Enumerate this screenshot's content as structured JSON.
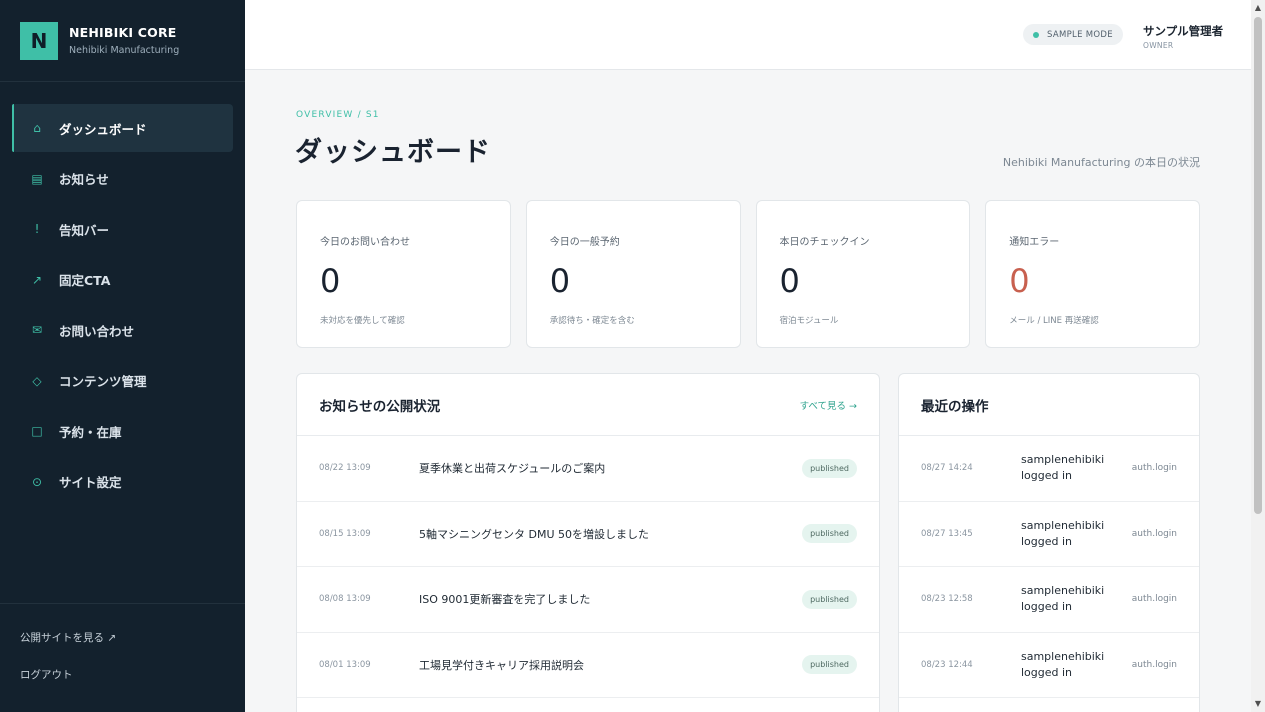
{
  "brand": {
    "logo_letter": "N",
    "name": "NEHIBIKI CORE",
    "sub": "Nehibiki Manufacturing"
  },
  "sidebar": {
    "items": [
      {
        "label": "ダッシュボード",
        "icon": "⌂",
        "active": true
      },
      {
        "label": "お知らせ",
        "icon": "▤"
      },
      {
        "label": "告知バー",
        "icon": "!"
      },
      {
        "label": "固定CTA",
        "icon": "↗"
      },
      {
        "label": "お問い合わせ",
        "icon": "✉"
      },
      {
        "label": "コンテンツ管理",
        "icon": "◇"
      },
      {
        "label": "予約・在庫",
        "icon": "□"
      },
      {
        "label": "サイト設定",
        "icon": "⊙"
      }
    ],
    "footer": {
      "public_site": "公開サイトを見る ↗",
      "logout": "ログアウト"
    }
  },
  "header": {
    "mode": "SAMPLE MODE",
    "user_name": "サンプル管理者",
    "user_role": "OWNER"
  },
  "page": {
    "crumb": "OVERVIEW / S1",
    "title": "ダッシュボード",
    "subtitle": "Nehibiki Manufacturing の本日の状況"
  },
  "stats": [
    {
      "label": "今日のお問い合わせ",
      "value": "0",
      "note": "未対応を優先して確認"
    },
    {
      "label": "今日の一般予約",
      "value": "0",
      "note": "承認待ち・確定を含む"
    },
    {
      "label": "本日のチェックイン",
      "value": "0",
      "note": "宿泊モジュール"
    },
    {
      "label": "通知エラー",
      "value": "0",
      "note": "メール / LINE 再送確認"
    }
  ],
  "news": {
    "title": "お知らせの公開状況",
    "view_all": "すべて見る →",
    "rows": [
      {
        "date": "08/22 13:09",
        "title": "夏季休業と出荷スケジュールのご案内",
        "status": "published"
      },
      {
        "date": "08/15 13:09",
        "title": "5軸マシニングセンタ DMU 50を増設しました",
        "status": "published"
      },
      {
        "date": "08/08 13:09",
        "title": "ISO 9001更新審査を完了しました",
        "status": "published"
      },
      {
        "date": "08/01 13:09",
        "title": "工場見学付きキャリア採用説明会",
        "status": "published"
      }
    ]
  },
  "log": {
    "title": "最近の操作",
    "rows": [
      {
        "date": "08/27 14:24",
        "text": "samplenehibiki logged in",
        "action": "auth.login"
      },
      {
        "date": "08/27 13:45",
        "text": "samplenehibiki logged in",
        "action": "auth.login"
      },
      {
        "date": "08/23 12:58",
        "text": "samplenehibiki logged in",
        "action": "auth.login"
      },
      {
        "date": "08/23 12:44",
        "text": "samplenehibiki logged in",
        "action": "auth.login"
      }
    ]
  },
  "colors": {
    "accent": "#3fbfa7",
    "sidebar_bg": "#13212d",
    "error": "#c8604f"
  }
}
